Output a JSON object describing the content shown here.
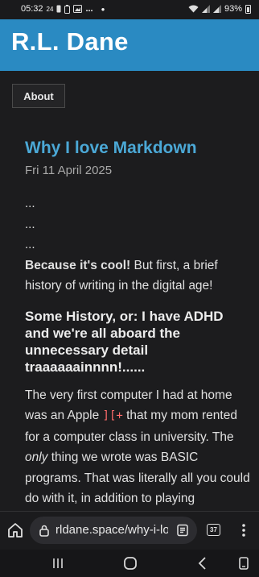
{
  "status_bar": {
    "time": "05:32",
    "data_indicator": "24",
    "more_notifications": "...",
    "battery_percent": "93%",
    "icons": [
      "sim-icon",
      "battery-saver-icon",
      "gallery-icon",
      "wifi-icon",
      "signal-icon",
      "signal-icon",
      "battery-icon"
    ]
  },
  "site": {
    "title": "R.L. Dane",
    "header_color": "#2a8ac2",
    "nav": {
      "about_label": "About"
    }
  },
  "post": {
    "title": "Why I love Markdown",
    "date": "Fri 11 April 2025",
    "dots": [
      "...",
      "...",
      "..."
    ],
    "intro_bold": "Because it's cool!",
    "intro_rest": " But first, a brief history of writing in the digital age!",
    "subheading": "Some History, or: I have ADHD and we're all aboard the unnecessary detail traaaaaainnnn!......",
    "body_1": "The very first computer I had at home was an Apple ",
    "code": "][+",
    "body_2": " that my mom rented for a computer class in university. The ",
    "body_em": "only",
    "body_3": " thing we wrote was BASIC programs. That was literally all you could do with it, in addition to playing",
    "title_color": "#4ba8d6",
    "code_color": "#ff6b6b"
  },
  "browser": {
    "url": "rldane.space/why-i-lo",
    "tab_count": "37",
    "icons": [
      "home-icon",
      "lock-icon",
      "reader-mode-icon",
      "tabs-icon",
      "more-vert-icon"
    ]
  },
  "system_nav": {
    "icons": [
      "recents-icon",
      "home-circle-icon",
      "back-icon",
      "rotate-icon"
    ]
  }
}
